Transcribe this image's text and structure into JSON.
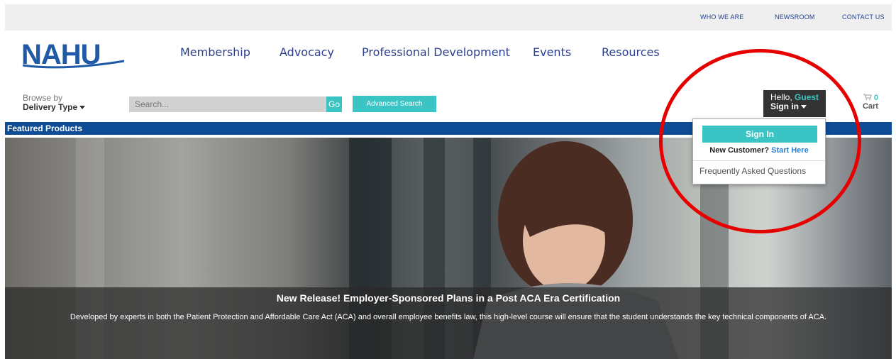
{
  "top_links": [
    "WHO WE ARE",
    "NEWSROOM",
    "CONTACT US"
  ],
  "logo_text": "NAHU",
  "nav": [
    "Membership",
    "Advocacy",
    "Professional Development",
    "Events",
    "Resources"
  ],
  "browse": {
    "label": "Browse by",
    "value": "Delivery Type"
  },
  "search": {
    "placeholder": "Search...",
    "go_label": "Go",
    "advanced_label": "Advanced Search"
  },
  "account": {
    "hello": "Hello,",
    "guest": "Guest",
    "signin": "Sign in"
  },
  "cart": {
    "count": "0",
    "label": "Cart"
  },
  "featured_label": "Featured Products",
  "hero": {
    "title": "New Release! Employer-Sponsored Plans in a Post ACA Era Certification",
    "description": "Developed by experts in both the Patient Protection and Affordable Care Act (ACA) and overall employee benefits law, this high-level course will ensure that the student understands the key technical components of ACA."
  },
  "dropdown": {
    "signin_button": "Sign In",
    "new_customer": "New Customer?",
    "start_here": "Start Here",
    "faq": "Frequently Asked Questions"
  },
  "colors": {
    "brand_blue": "#0e4c96",
    "accent_teal": "#3bc4c4",
    "nav_blue": "#2b3f8c",
    "annotation_red": "#e60000"
  }
}
